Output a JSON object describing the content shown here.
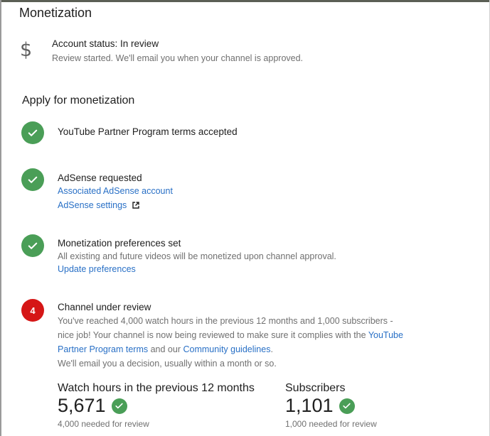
{
  "page": {
    "title": "Monetization"
  },
  "account_status": {
    "icon": "dollar-icon",
    "title": "Account status: In review",
    "subtitle": "Review started. We'll email you when your channel is approved."
  },
  "apply": {
    "title": "Apply for monetization",
    "steps": [
      {
        "icon": "check-icon",
        "title": "YouTube Partner Program terms accepted"
      },
      {
        "icon": "check-icon",
        "title": "AdSense requested",
        "links": [
          "Associated AdSense account",
          "AdSense settings"
        ]
      },
      {
        "icon": "check-icon",
        "title": "Monetization preferences set",
        "description": "All existing and future videos will be monetized upon channel approval.",
        "link": "Update preferences"
      },
      {
        "icon": "step-number",
        "number": "4",
        "title": "Channel under review",
        "description_parts": [
          "You've reached 4,000 watch hours in the previous 12 months and 1,000 subscribers - nice job! Your channel is now being reviewed to make sure it complies with the ",
          "YouTube Partner Program terms",
          " and our ",
          "Community guidelines",
          ".",
          "We'll email you a decision, usually within a month or so."
        ]
      }
    ]
  },
  "metrics": [
    {
      "label": "Watch hours in the previous 12 months",
      "value": "5,671",
      "note": "4,000 needed for review"
    },
    {
      "label": "Subscribers",
      "value": "1,101",
      "note": "1,000 needed for review"
    }
  ],
  "colors": {
    "success": "#4a9e57",
    "alert": "#d51616",
    "link": "#2970c6"
  }
}
